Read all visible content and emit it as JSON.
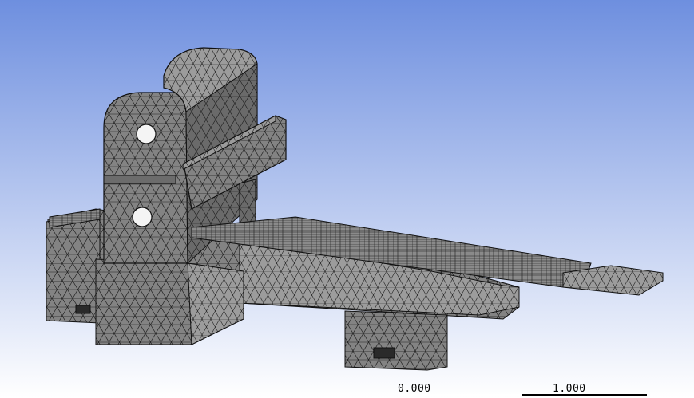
{
  "viewport": {
    "background_top": "#6e8fdf",
    "background_bottom": "#ffffff",
    "mesh_fill": "#808080",
    "mesh_fill_light": "#9a9a9a",
    "mesh_fill_dark": "#5e5e5e",
    "mesh_edge": "#1a1a1a"
  },
  "scale_bar": {
    "label_start": "0.000",
    "label_end": "1.000"
  }
}
